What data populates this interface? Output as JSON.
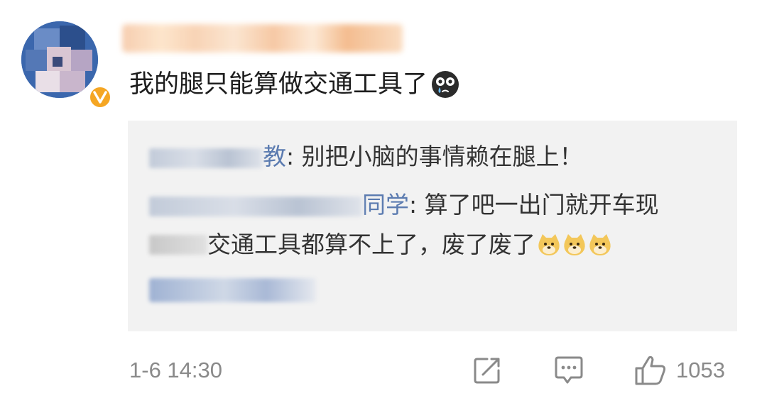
{
  "comment": {
    "text": "我的腿只能算做交通工具了",
    "emoji": "crying-face-emoji"
  },
  "replies": [
    {
      "name_visible": "教",
      "text": ": 别把小脑的事情赖在腿上！"
    },
    {
      "name_visible": "同学",
      "text_line1": ": 算了吧一出门就开车现",
      "text_line2": "交通工具都算不上了，废了废了",
      "emoji": "doge-emoji"
    }
  ],
  "footer": {
    "timestamp": "1-6 14:30",
    "share_icon": "share-icon",
    "comment_icon": "comment-icon",
    "like_icon": "thumbs-up-icon",
    "like_count": "1053"
  },
  "colors": {
    "reply_box_bg": "#f2f2f2",
    "name_link": "#5b7bb0",
    "meta_gray": "#8a8a8a",
    "badge": "#f5a623"
  }
}
